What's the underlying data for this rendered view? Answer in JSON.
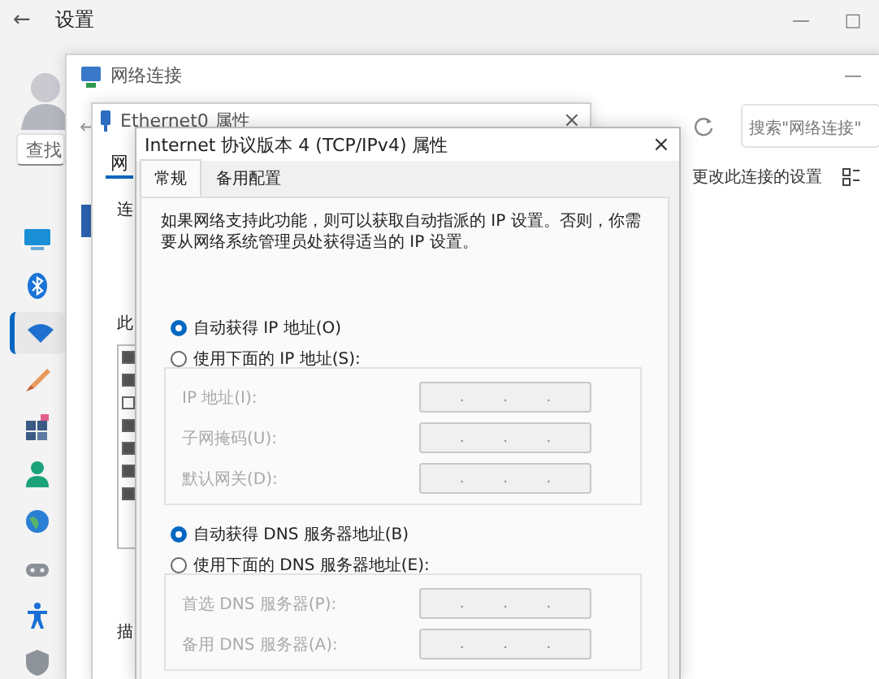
{
  "settings": {
    "title": "设置",
    "back": "←",
    "controls": [
      "—",
      "□"
    ],
    "search": {
      "placeholder": "查找"
    },
    "sidebar": [
      {
        "kind": "display",
        "selected": false
      },
      {
        "kind": "bluetooth",
        "selected": false
      },
      {
        "kind": "network",
        "selected": true
      },
      {
        "kind": "brush",
        "selected": false
      },
      {
        "kind": "apps",
        "selected": false
      },
      {
        "kind": "person",
        "selected": false
      },
      {
        "kind": "globe",
        "selected": false
      },
      {
        "kind": "gaming",
        "selected": false
      },
      {
        "kind": "accessibility",
        "selected": false
      },
      {
        "kind": "shield",
        "selected": false
      }
    ]
  },
  "network_window": {
    "title": "网络连接",
    "back": "←",
    "controls": [
      "—"
    ],
    "search": {
      "placeholder": "搜索\"网络连接\""
    },
    "commands": [
      "更改此连接的设置"
    ]
  },
  "ethernet_window": {
    "title": "Ethernet0 属性",
    "close": "×",
    "tabs": [
      {
        "label": "网",
        "selected": true
      }
    ],
    "labels": [
      "连",
      "此"
    ],
    "components": [
      {
        "checked": true
      },
      {
        "checked": true
      },
      {
        "checked": false
      },
      {
        "checked": true
      },
      {
        "checked": true
      },
      {
        "checked": true
      },
      {
        "checked": true
      }
    ],
    "footer_label": "描"
  },
  "ipv4_dialog": {
    "title": "Internet 协议版本 4 (TCP/IPv4) 属性",
    "close": "×",
    "tabs": [
      {
        "label": "常规",
        "selected": true
      },
      {
        "label": "备用配置",
        "selected": false
      }
    ],
    "intro": "如果网络支持此功能，则可以获取自动指派的 IP 设置。否则，你需要从网络系统管理员处获得适当的 IP 设置。",
    "sections": [
      {
        "options": [
          {
            "label": "自动获得 IP 地址(O)",
            "selected": true
          },
          {
            "label": "使用下面的 IP 地址(S):",
            "selected": false
          }
        ],
        "fields": [
          {
            "label": "IP 地址(I):",
            "separators": [
              ".",
              ".",
              "."
            ],
            "disabled": true
          },
          {
            "label": "子网掩码(U):",
            "separators": [
              ".",
              ".",
              "."
            ],
            "disabled": true
          },
          {
            "label": "默认网关(D):",
            "separators": [
              ".",
              ".",
              "."
            ],
            "disabled": true
          }
        ]
      },
      {
        "options": [
          {
            "label": "自动获得 DNS 服务器地址(B)",
            "selected": true
          },
          {
            "label": "使用下面的 DNS 服务器地址(E):",
            "selected": false
          }
        ],
        "fields": [
          {
            "label": "首选 DNS 服务器(P):",
            "separators": [
              ".",
              ".",
              "."
            ],
            "disabled": true
          },
          {
            "label": "备用 DNS 服务器(A):",
            "separators": [
              ".",
              ".",
              "."
            ],
            "disabled": true
          }
        ]
      }
    ]
  }
}
